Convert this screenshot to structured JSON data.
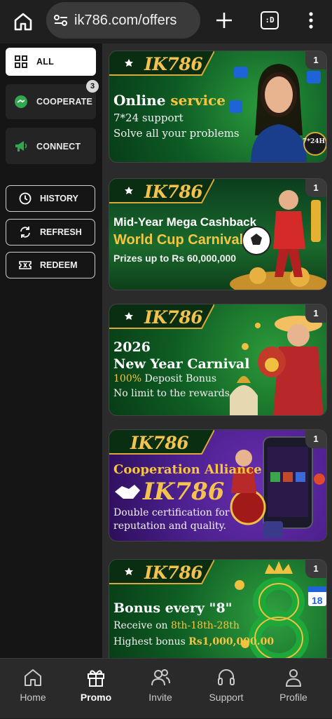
{
  "browser": {
    "url": "ik786.com/offers",
    "tab_switcher_label": ":D"
  },
  "sidebar": {
    "tabs": [
      {
        "label": "ALL",
        "icon": "grid-icon"
      },
      {
        "label": "COOPERATE",
        "icon": "handshake-icon",
        "badge": "3"
      },
      {
        "label": "CONNECT",
        "icon": "megaphone-icon"
      }
    ],
    "buttons": [
      {
        "label": "HISTORY",
        "icon": "clock-icon"
      },
      {
        "label": "REFRESH",
        "icon": "refresh-icon"
      },
      {
        "label": "REDEEM",
        "icon": "ticket-icon"
      }
    ]
  },
  "cards": [
    {
      "brand": "IK786",
      "count": "1",
      "lines": [
        "Online service",
        "7*24 support",
        "Solve all your problems"
      ],
      "badge_text": "7*24H"
    },
    {
      "brand": "IK786",
      "count": "1",
      "lines": [
        "Mid-Year Mega Cashback",
        "World Cup Carnival",
        "Prizes up to Rs 60,000,000"
      ]
    },
    {
      "brand": "IK786",
      "count": "1",
      "lines": [
        "2026",
        "New Year Carnival",
        "100% Deposit Bonus",
        "No limit to the rewards"
      ]
    },
    {
      "brand": "IK786",
      "count": "1",
      "lines": [
        "Cooperation Alliance",
        "IK786",
        "Double certification for",
        "reputation and quality."
      ]
    },
    {
      "brand": "IK786",
      "count": "1",
      "lines": [
        "Bonus every \"8\"",
        "Receive on 8th-18th-28th",
        "Highest bonus Rs1,000,000.00"
      ],
      "calendar_day": "18"
    }
  ],
  "bottom_nav": [
    {
      "label": "Home",
      "icon": "home-icon"
    },
    {
      "label": "Promo",
      "icon": "gift-icon",
      "active": true
    },
    {
      "label": "Invite",
      "icon": "people-icon"
    },
    {
      "label": "Support",
      "icon": "headset-icon"
    },
    {
      "label": "Profile",
      "icon": "person-icon"
    }
  ],
  "colors": {
    "gold": "#f5c542",
    "card_green": "#0d5a24",
    "card_purple": "#4a1f8c"
  }
}
